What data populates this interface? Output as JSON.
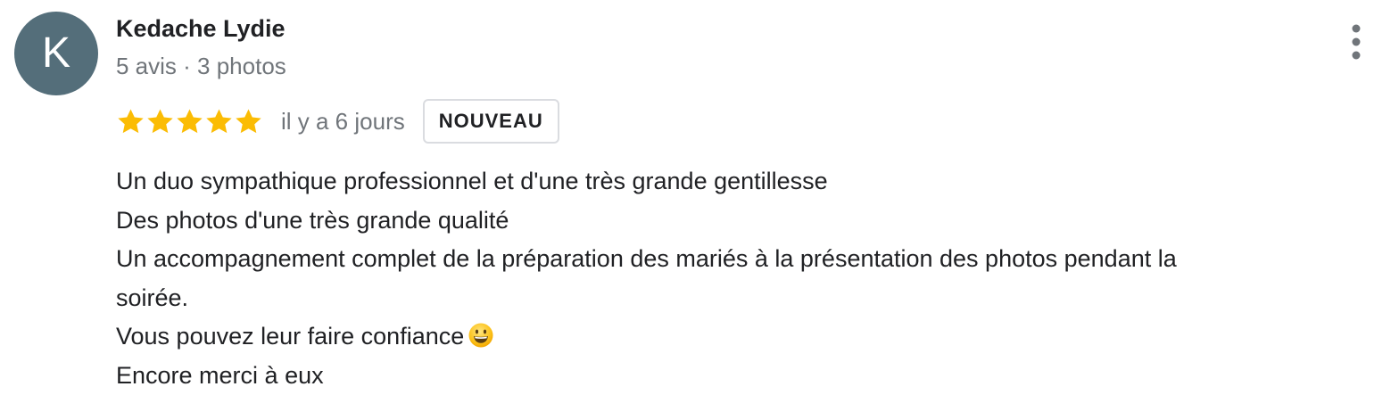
{
  "review": {
    "avatar_letter": "K",
    "author_name": "Kedache Lydie",
    "author_meta": "5 avis · 3 photos",
    "rating": 5,
    "rating_max": 5,
    "date": "il y a 6 jours",
    "badge": "NOUVEAU",
    "text_lines": [
      "Un duo sympathique professionnel et d'une très grande gentillesse",
      "Des photos d'une très grande qualité",
      "Un accompagnement complet de la préparation des mariés à la présentation des photos pendant la",
      "soirée.",
      "Vous pouvez leur faire confiance",
      "Encore merci à eux"
    ],
    "emoji": "grinning-face-emoji",
    "colors": {
      "avatar_bg": "#546e7a",
      "star": "#fbbc04",
      "meta_text": "#70757a",
      "badge_border": "#dadce0"
    },
    "icons": {
      "menu": "more-vert-icon",
      "star": "star-icon"
    }
  }
}
